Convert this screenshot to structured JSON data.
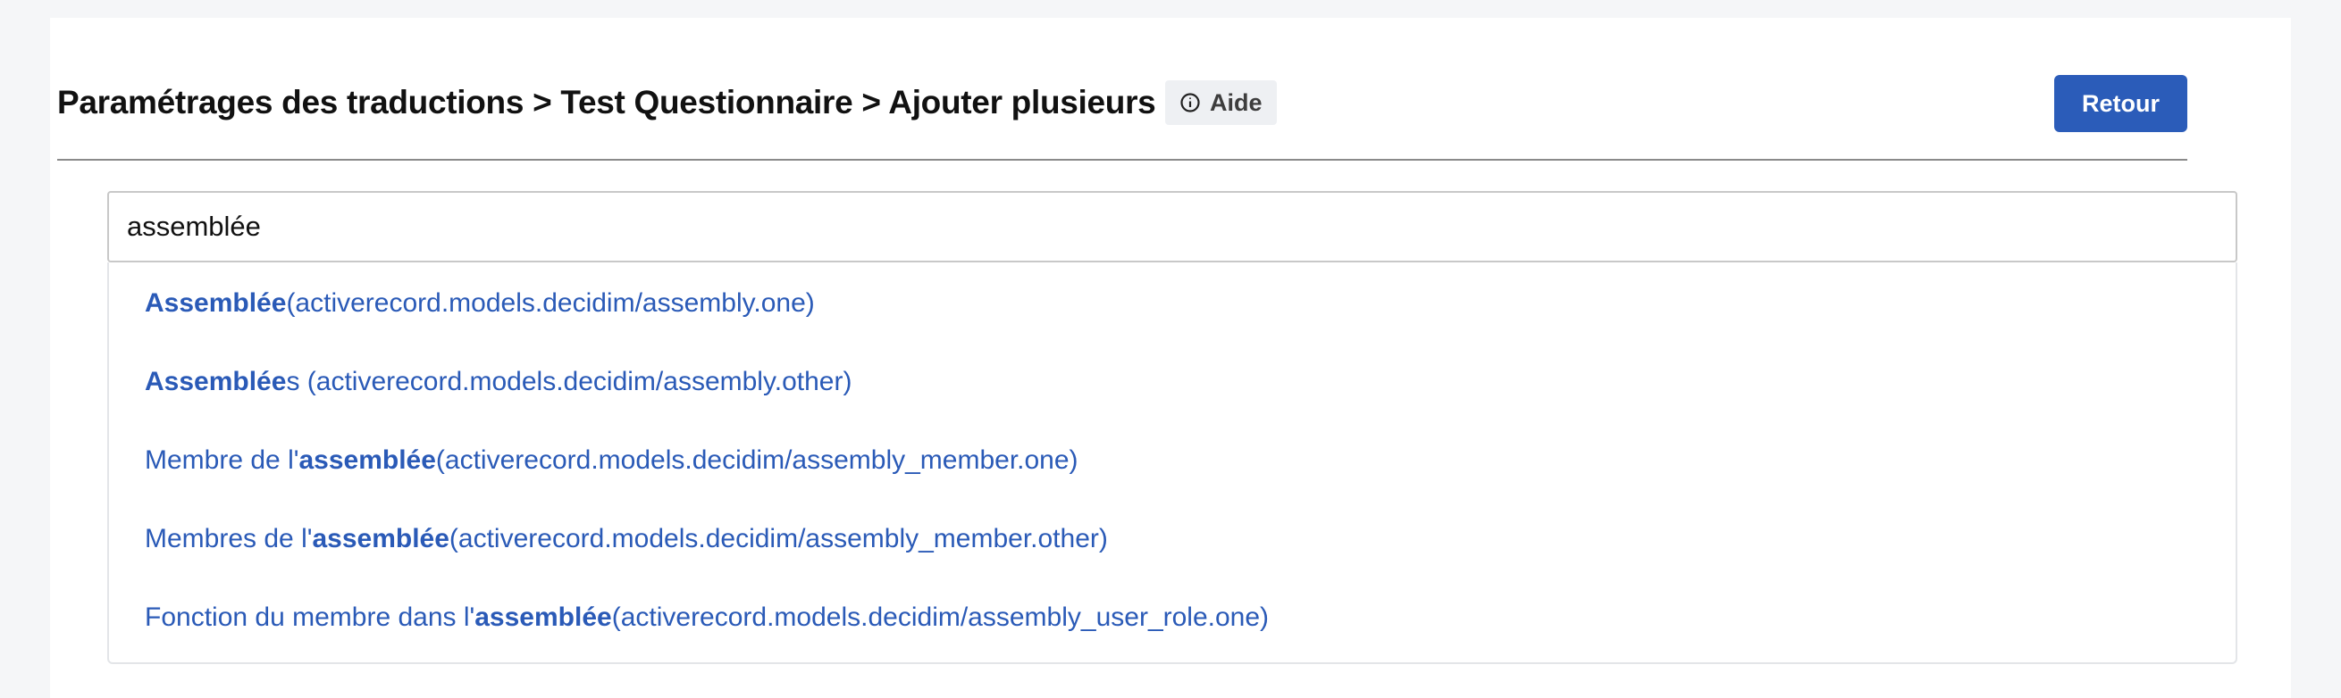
{
  "header": {
    "title": "Paramétrages des traductions > Test Questionnaire > Ajouter plusieurs",
    "help_label": "Aide",
    "back_label": "Retour"
  },
  "search": {
    "value": "assemblée"
  },
  "suggestions": [
    {
      "prefix": "",
      "match": "Assemblée",
      "suffix": " (activerecord.models.decidim/assembly.one)"
    },
    {
      "prefix": "",
      "match": "Assemblée",
      "suffix": "s (activerecord.models.decidim/assembly.other)"
    },
    {
      "prefix": "Membre de l'",
      "match": "assemblée",
      "suffix": " (activerecord.models.decidim/assembly_member.one)"
    },
    {
      "prefix": "Membres de l'",
      "match": "assemblée",
      "suffix": " (activerecord.models.decidim/assembly_member.other)"
    },
    {
      "prefix": "Fonction du membre dans l'",
      "match": "assemblée",
      "suffix": " (activerecord.models.decidim/assembly_user_role.one)"
    }
  ],
  "colors": {
    "primary": "#2b5cb9",
    "link": "#2a5ab7",
    "help_bg": "#eef0f3",
    "page_bg": "#f5f6f8"
  },
  "icons": {
    "help": "info-circle-icon"
  }
}
